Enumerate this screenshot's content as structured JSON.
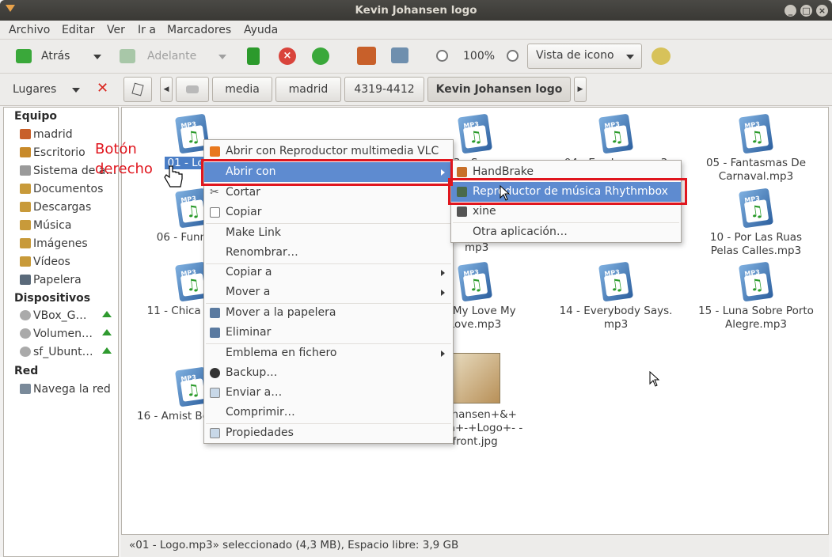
{
  "window": {
    "title": "Kevin Johansen logo"
  },
  "menubar": [
    "Archivo",
    "Editar",
    "Ver",
    "Ir a",
    "Marcadores",
    "Ayuda"
  ],
  "toolbar": {
    "back": "Atrás",
    "forward": "Adelante",
    "zoom": "100%",
    "view_mode": "Vista de icono"
  },
  "location": {
    "places_label": "Lugares",
    "crumbs": [
      "media",
      "madrid",
      "4319-4412",
      "Kevin Johansen logo"
    ]
  },
  "sidebar": {
    "sections": [
      {
        "title": "Equipo",
        "items": [
          "madrid",
          "Escritorio",
          "Sistema de a…",
          "Documentos",
          "Descargas",
          "Música",
          "Imágenes",
          "Vídeos",
          "Papelera"
        ]
      },
      {
        "title": "Dispositivos",
        "items": [
          "VBox_G…",
          "Volumen…",
          "sf_Ubunt…"
        ]
      },
      {
        "title": "Red",
        "items": [
          "Navega la red"
        ]
      }
    ]
  },
  "files": [
    {
      "name": "01 - Logo",
      "selected": true
    },
    {
      "name": "03 - Susan"
    },
    {
      "name": "04 - Ese Lugar.mp3"
    },
    {
      "name": "05 - Fantasmas De Carnaval.mp3"
    },
    {
      "name": "06 - Funny Fa"
    },
    {
      "name": "mp3"
    },
    {
      "name": "10 - Por Las Ruas Pelas Calles.mp3"
    },
    {
      "name": "11 - Chica F mp3"
    },
    {
      "name": "Oh My Love My Love.mp3"
    },
    {
      "name": "14 - Everybody Says. mp3"
    },
    {
      "name": "15 - Luna Sobre Porto Alegre.mp3"
    },
    {
      "name": "16 - Amist Borracher"
    },
    {
      "name": "+Johansen+&+ Nada+-+Logo+- -front.jpg"
    }
  ],
  "context_menu": {
    "items": [
      "Abrir con Reproductor multimedia VLC",
      "Abrir con",
      "Cortar",
      "Copiar",
      "Make Link",
      "Renombrar…",
      "Copiar a",
      "Mover a",
      "Mover a la papelera",
      "Eliminar",
      "Emblema en fichero",
      "Backup…",
      "Enviar a…",
      "Comprimir…",
      "Propiedades"
    ]
  },
  "submenu": {
    "items": [
      "HandBrake",
      "Reproductor de música Rhythmbox",
      "xine",
      "Otra aplicación…"
    ]
  },
  "annotation": {
    "line1": "Botón",
    "line2": "derecho"
  },
  "status": "«01 - Logo.mp3» seleccionado (4,3 MB), Espacio libre: 3,9 GB",
  "colors": {
    "highlight": "#5e8bd0",
    "annotation": "#e0161e",
    "titlebar": "#3c3b37"
  }
}
